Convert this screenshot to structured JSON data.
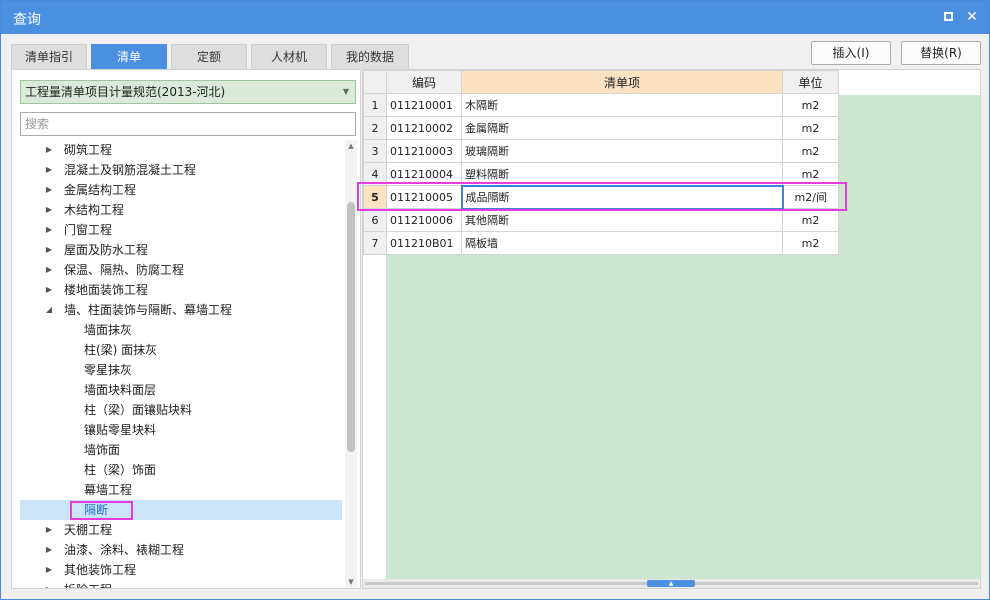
{
  "window": {
    "title": "查询"
  },
  "tabs": [
    {
      "label": "清单指引",
      "active": false
    },
    {
      "label": "清单",
      "active": true
    },
    {
      "label": "定额",
      "active": false
    },
    {
      "label": "人材机",
      "active": false
    },
    {
      "label": "我的数据",
      "active": false
    }
  ],
  "actions": {
    "insert": "插入(I)",
    "replace": "替换(R)"
  },
  "left": {
    "standard": "工程量清单项目计量规范(2013-河北)",
    "search_placeholder": "搜索",
    "tree": [
      {
        "label": "砌筑工程",
        "level": 1,
        "expandable": true,
        "expanded": false
      },
      {
        "label": "混凝土及钢筋混凝土工程",
        "level": 1,
        "expandable": true,
        "expanded": false
      },
      {
        "label": "金属结构工程",
        "level": 1,
        "expandable": true,
        "expanded": false
      },
      {
        "label": "木结构工程",
        "level": 1,
        "expandable": true,
        "expanded": false
      },
      {
        "label": "门窗工程",
        "level": 1,
        "expandable": true,
        "expanded": false
      },
      {
        "label": "屋面及防水工程",
        "level": 1,
        "expandable": true,
        "expanded": false
      },
      {
        "label": "保温、隔热、防腐工程",
        "level": 1,
        "expandable": true,
        "expanded": false
      },
      {
        "label": "楼地面装饰工程",
        "level": 1,
        "expandable": true,
        "expanded": false
      },
      {
        "label": "墙、柱面装饰与隔断、幕墙工程",
        "level": 1,
        "expandable": true,
        "expanded": true
      },
      {
        "label": "墙面抹灰",
        "level": 2
      },
      {
        "label": "柱(梁) 面抹灰",
        "level": 2
      },
      {
        "label": "零星抹灰",
        "level": 2
      },
      {
        "label": "墙面块料面层",
        "level": 2
      },
      {
        "label": "柱（梁）面镶贴块料",
        "level": 2
      },
      {
        "label": "镶贴零星块料",
        "level": 2
      },
      {
        "label": "墙饰面",
        "level": 2
      },
      {
        "label": "柱（梁）饰面",
        "level": 2
      },
      {
        "label": "幕墙工程",
        "level": 2
      },
      {
        "label": "隔断",
        "level": 2,
        "selected": true
      },
      {
        "label": "天棚工程",
        "level": 1,
        "expandable": true,
        "expanded": false
      },
      {
        "label": "油漆、涂料、裱糊工程",
        "level": 1,
        "expandable": true,
        "expanded": false
      },
      {
        "label": "其他装饰工程",
        "level": 1,
        "expandable": true,
        "expanded": false
      },
      {
        "label": "拆除工程",
        "level": 1,
        "expandable": true,
        "expanded": false
      }
    ]
  },
  "grid": {
    "headers": {
      "rownum": "",
      "code": "编码",
      "name": "清单项",
      "unit": "单位"
    },
    "rows": [
      {
        "num": "1",
        "code": "011210001",
        "name": "木隔断",
        "unit": "m2"
      },
      {
        "num": "2",
        "code": "011210002",
        "name": "金属隔断",
        "unit": "m2"
      },
      {
        "num": "3",
        "code": "011210003",
        "name": "玻璃隔断",
        "unit": "m2"
      },
      {
        "num": "4",
        "code": "011210004",
        "name": "塑料隔断",
        "unit": "m2"
      },
      {
        "num": "5",
        "code": "011210005",
        "name": "成品隔断",
        "unit": "m2/间",
        "selected": true
      },
      {
        "num": "6",
        "code": "011210006",
        "name": "其他隔断",
        "unit": "m2"
      },
      {
        "num": "7",
        "code": "011210B01",
        "name": "隔板墙",
        "unit": "m2"
      }
    ]
  },
  "colors": {
    "accent": "#4a8fe0",
    "highlight": "#e43ce0",
    "grid_bg": "#cde6d0"
  }
}
